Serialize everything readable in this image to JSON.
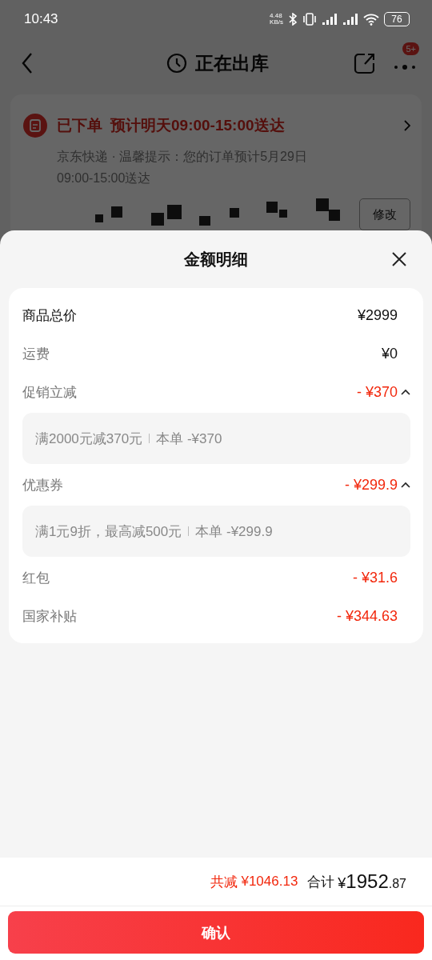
{
  "status_bar": {
    "time": "10:43",
    "net_speed": "4.48",
    "net_unit": "KB/s",
    "battery": "76"
  },
  "header": {
    "title": "正在出库",
    "badge": "5+"
  },
  "order": {
    "status": "已下单",
    "eta": "预计明天09:00-15:00送达",
    "note": "京东快递 · 温馨提示：您的订单预计5月29日09:00-15:00送达",
    "edit_button": "修改"
  },
  "sheet": {
    "title": "金额明细",
    "rows": [
      {
        "kind": "total",
        "label": "商品总价",
        "amount": "¥2999"
      },
      {
        "kind": "plain",
        "label": "运费",
        "amount": "¥0"
      },
      {
        "kind": "discount",
        "label": "促销立减",
        "amount": "- ¥370",
        "expanded": true,
        "detail": {
          "rule": "满2000元减370元",
          "this_order": "本单 -¥370"
        }
      },
      {
        "kind": "discount",
        "label": "优惠券",
        "amount": "- ¥299.9",
        "expanded": true,
        "detail": {
          "rule": "满1元9折，最高减500元",
          "this_order": "本单 -¥299.9"
        }
      },
      {
        "kind": "discount",
        "label": "红包",
        "amount": "- ¥31.6"
      },
      {
        "kind": "discount",
        "label": "国家补贴",
        "amount": "- ¥344.63"
      }
    ]
  },
  "footer": {
    "saved_label": "共减",
    "saved": "¥1046.13",
    "total_label": "合计",
    "currency": "¥",
    "total_int": "1952",
    "total_dec": ".87",
    "confirm": "确认"
  }
}
